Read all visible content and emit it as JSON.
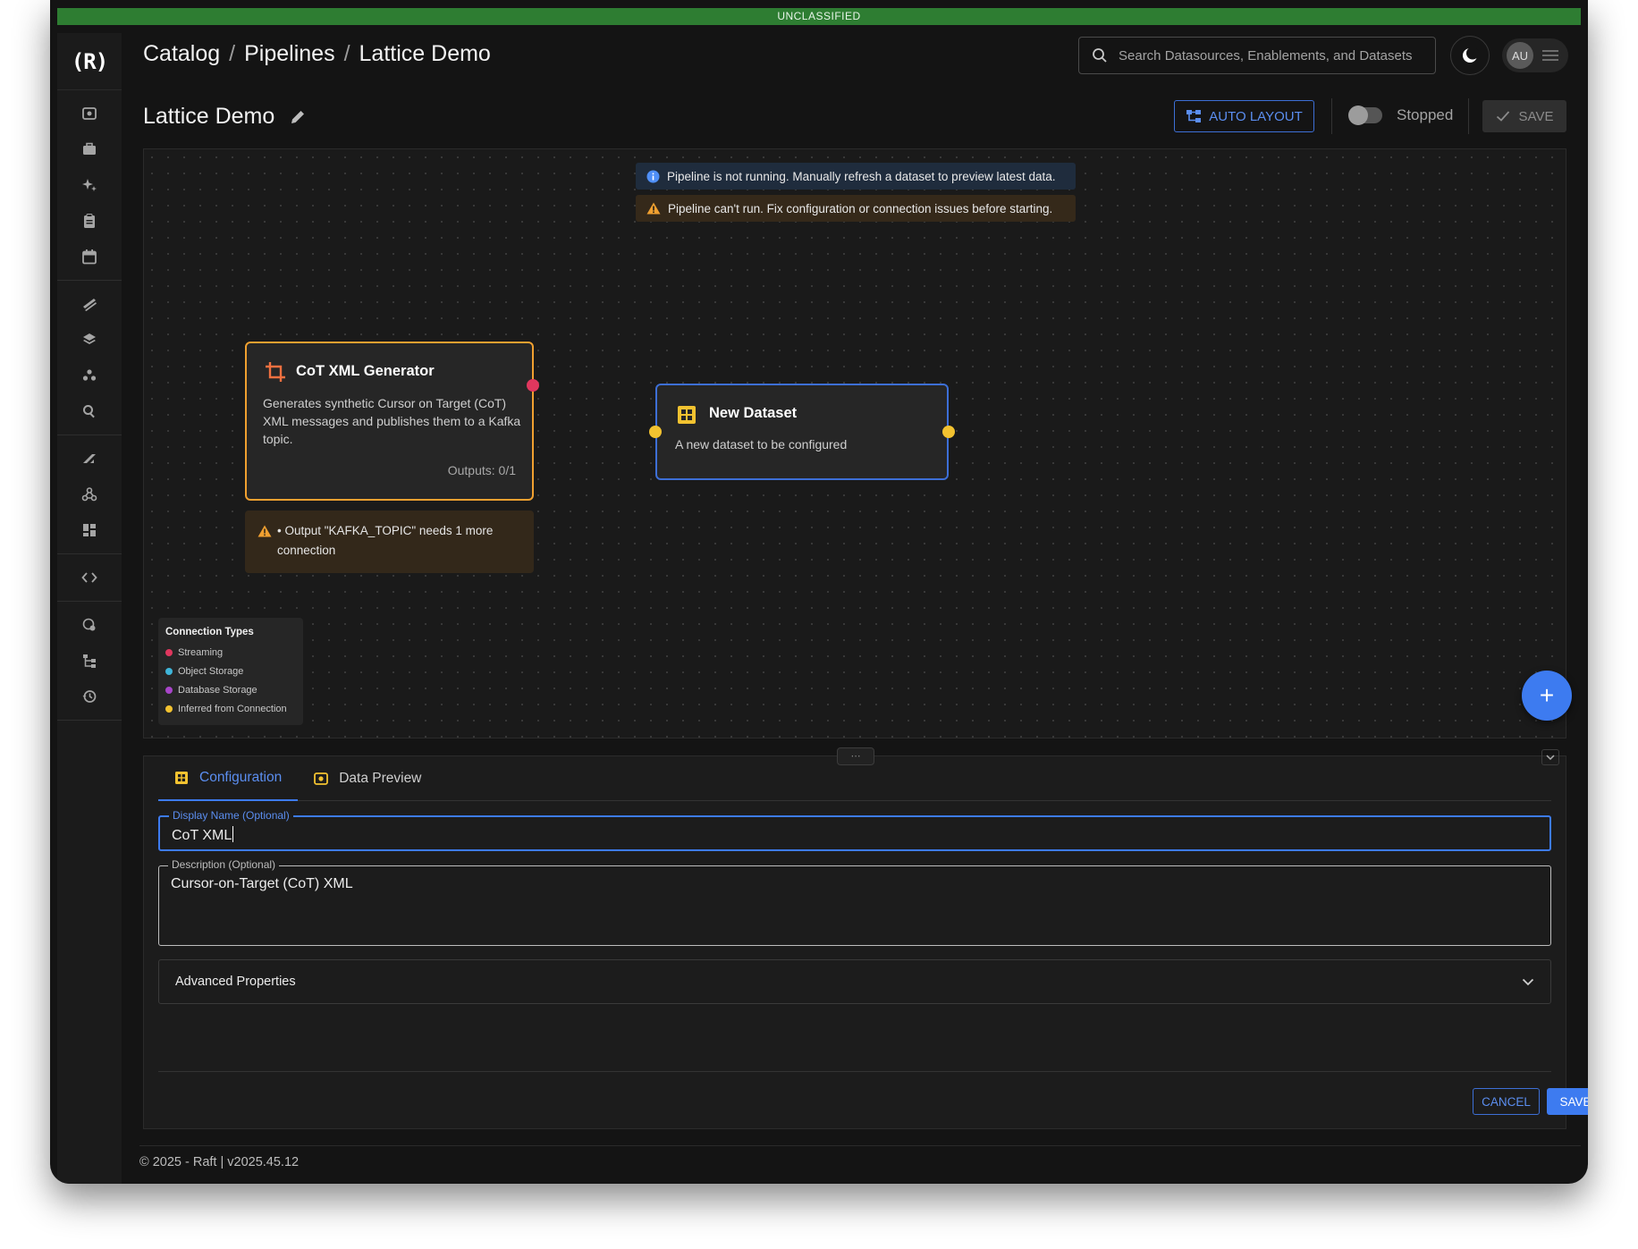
{
  "classification": "UNCLASSIFIED",
  "brand": {
    "logo_text": "(R)"
  },
  "breadcrumb": {
    "items": [
      "Catalog",
      "Pipelines",
      "Lattice Demo"
    ],
    "separator": "/"
  },
  "search": {
    "placeholder": "Search Datasources, Enablements, and Datasets"
  },
  "user": {
    "initials": "AU"
  },
  "page": {
    "title": "Lattice Demo"
  },
  "toolbar": {
    "auto_layout_label": "AUTO LAYOUT",
    "status_label": "Stopped",
    "save_label": "SAVE"
  },
  "alerts": {
    "info": "Pipeline is not running. Manually refresh a dataset to preview latest data.",
    "warning": "Pipeline can't run. Fix configuration or connection issues before starting."
  },
  "nodes": {
    "generator": {
      "title": "CoT XML Generator",
      "description": "Generates synthetic Cursor on Target (CoT) XML messages and publishes them to a Kafka topic.",
      "outputs_label": "Outputs:",
      "outputs_value": "0/1",
      "warning": "• Output \"KAFKA_TOPIC\" needs 1 more connection"
    },
    "dataset": {
      "title": "New Dataset",
      "description": "A new dataset to be configured"
    }
  },
  "legend": {
    "title": "Connection Types",
    "items": [
      {
        "label": "Streaming",
        "color": "#e0375e"
      },
      {
        "label": "Object Storage",
        "color": "#3fb5d9"
      },
      {
        "label": "Database Storage",
        "color": "#a845c9"
      },
      {
        "label": "Inferred from Connection",
        "color": "#f2c230"
      }
    ]
  },
  "panel": {
    "tabs": [
      "Configuration",
      "Data Preview"
    ],
    "display_name": {
      "label": "Display Name (Optional)",
      "value": "CoT XML"
    },
    "description": {
      "label": "Description (Optional)",
      "value": "Cursor-on-Target (CoT) XML"
    },
    "advanced_label": "Advanced Properties",
    "cancel_label": "CANCEL",
    "save_label": "SAVE"
  },
  "footer": {
    "text": "© 2025 - Raft  | v2025.45.12"
  },
  "colors": {
    "accent": "#3d7bf0",
    "warning": "#f0a030",
    "classification_bar": "#2e7d32"
  }
}
